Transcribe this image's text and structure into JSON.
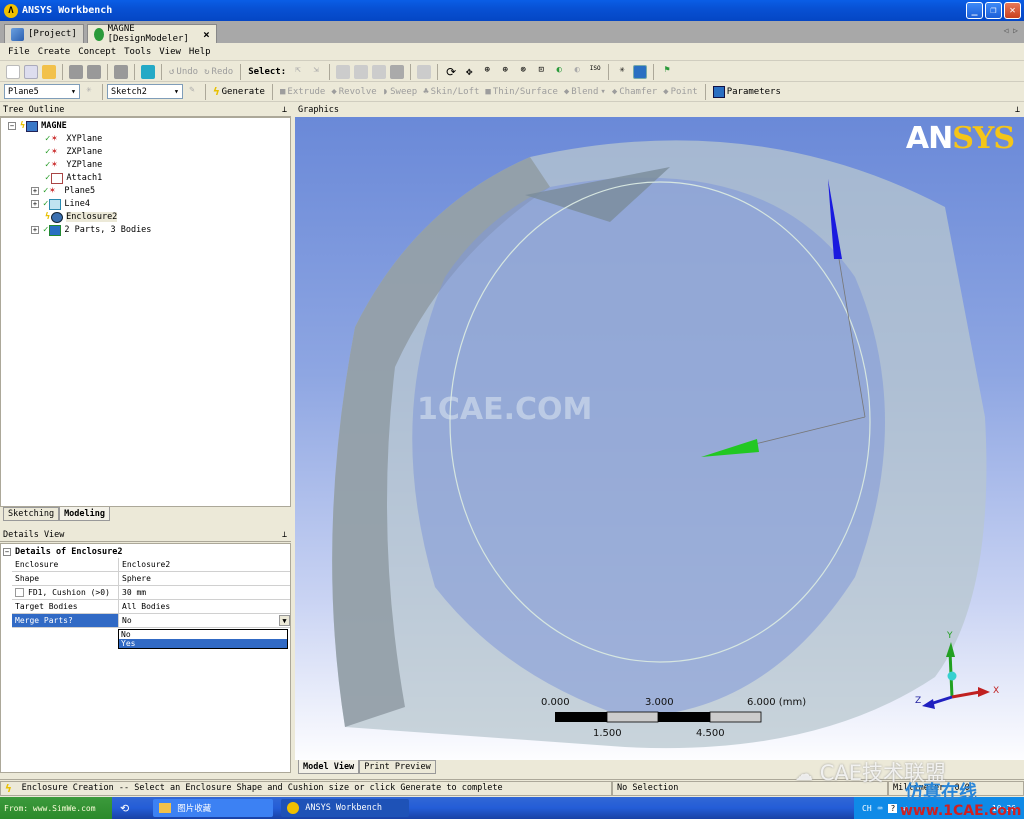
{
  "window": {
    "title": "ANSYS Workbench",
    "logo_glyph": "Λ"
  },
  "tabs": [
    {
      "label": "[Project]",
      "active": false
    },
    {
      "label": "MAGNE [DesignModeler]",
      "active": true
    }
  ],
  "tab_close": "×",
  "menu": [
    "File",
    "Create",
    "Concept",
    "Tools",
    "View",
    "Help"
  ],
  "toolbar1": {
    "undo": "Undo",
    "redo": "Redo",
    "select": "Select:"
  },
  "toolbar2": {
    "plane_select": "Plane5",
    "sketch_select": "Sketch2",
    "generate": "Generate",
    "extrude": "Extrude",
    "revolve": "Revolve",
    "sweep": "Sweep",
    "skin_loft": "Skin/Loft",
    "thin_surface": "Thin/Surface",
    "blend": "Blend",
    "chamfer": "Chamfer",
    "point": "Point",
    "parameters": "Parameters"
  },
  "tree_outline": {
    "title": "Tree Outline",
    "root": "MAGNE",
    "items": [
      {
        "label": "XYPlane",
        "icon": "plane-icon",
        "expandable": false
      },
      {
        "label": "ZXPlane",
        "icon": "plane-icon",
        "expandable": false
      },
      {
        "label": "YZPlane",
        "icon": "plane-icon",
        "expandable": false
      },
      {
        "label": "Attach1",
        "icon": "attach-icon",
        "expandable": false
      },
      {
        "label": "Plane5",
        "icon": "plane-icon",
        "expandable": true
      },
      {
        "label": "Line4",
        "icon": "line-body-icon",
        "expandable": true
      },
      {
        "label": "Enclosure2",
        "icon": "enclosure-icon",
        "expandable": false
      },
      {
        "label": "2 Parts, 3 Bodies",
        "icon": "parts-icon",
        "expandable": true
      }
    ]
  },
  "bottom_tabs": [
    "Sketching",
    "Modeling"
  ],
  "details_view": {
    "title": "Details View",
    "header": "Details of Enclosure2",
    "rows": [
      {
        "key": "Enclosure",
        "value": "Enclosure2"
      },
      {
        "key": "Shape",
        "value": "Sphere"
      },
      {
        "key": "FD1, Cushion (>0)",
        "value": "30 mm"
      },
      {
        "key": "Target Bodies",
        "value": "All Bodies"
      },
      {
        "key": "Merge Parts?",
        "value": "No"
      }
    ],
    "dropdown_options": [
      "No",
      "Yes"
    ],
    "dropdown_highlighted": "Yes"
  },
  "graphics": {
    "title": "Graphics",
    "brand_an": "AN",
    "brand_sys": "SYS",
    "watermark": "1CAE.COM",
    "scale": {
      "top_labels": [
        "0.000",
        "3.000",
        "6.000 (mm)"
      ],
      "bottom_labels": [
        "1.500",
        "4.500"
      ]
    },
    "triad": {
      "x": "X",
      "y": "Y",
      "z": "Z"
    },
    "view_tabs": [
      "Model View",
      "Print Preview"
    ]
  },
  "status": {
    "message": "Enclosure Creation -- Select an Enclosure Shape and Cushion size or click Generate to complete",
    "selection": "No Selection",
    "units": "Millimeter",
    "extra": "0  0"
  },
  "taskbar": {
    "start_label": "From: www.SimWe.com",
    "tasks": [
      "图片收藏",
      "ANSYS Workbench"
    ],
    "tray_lang": "CH",
    "clock": "10:36"
  },
  "overlays": {
    "wechat": "CAE技术联盟",
    "site_cn": "仿真在线",
    "site_url": "www.1CAE.com"
  },
  "colors": {
    "accent": "#316ac5",
    "viewport_top": "#6a89d8",
    "ansys_yellow": "#f5c518"
  }
}
